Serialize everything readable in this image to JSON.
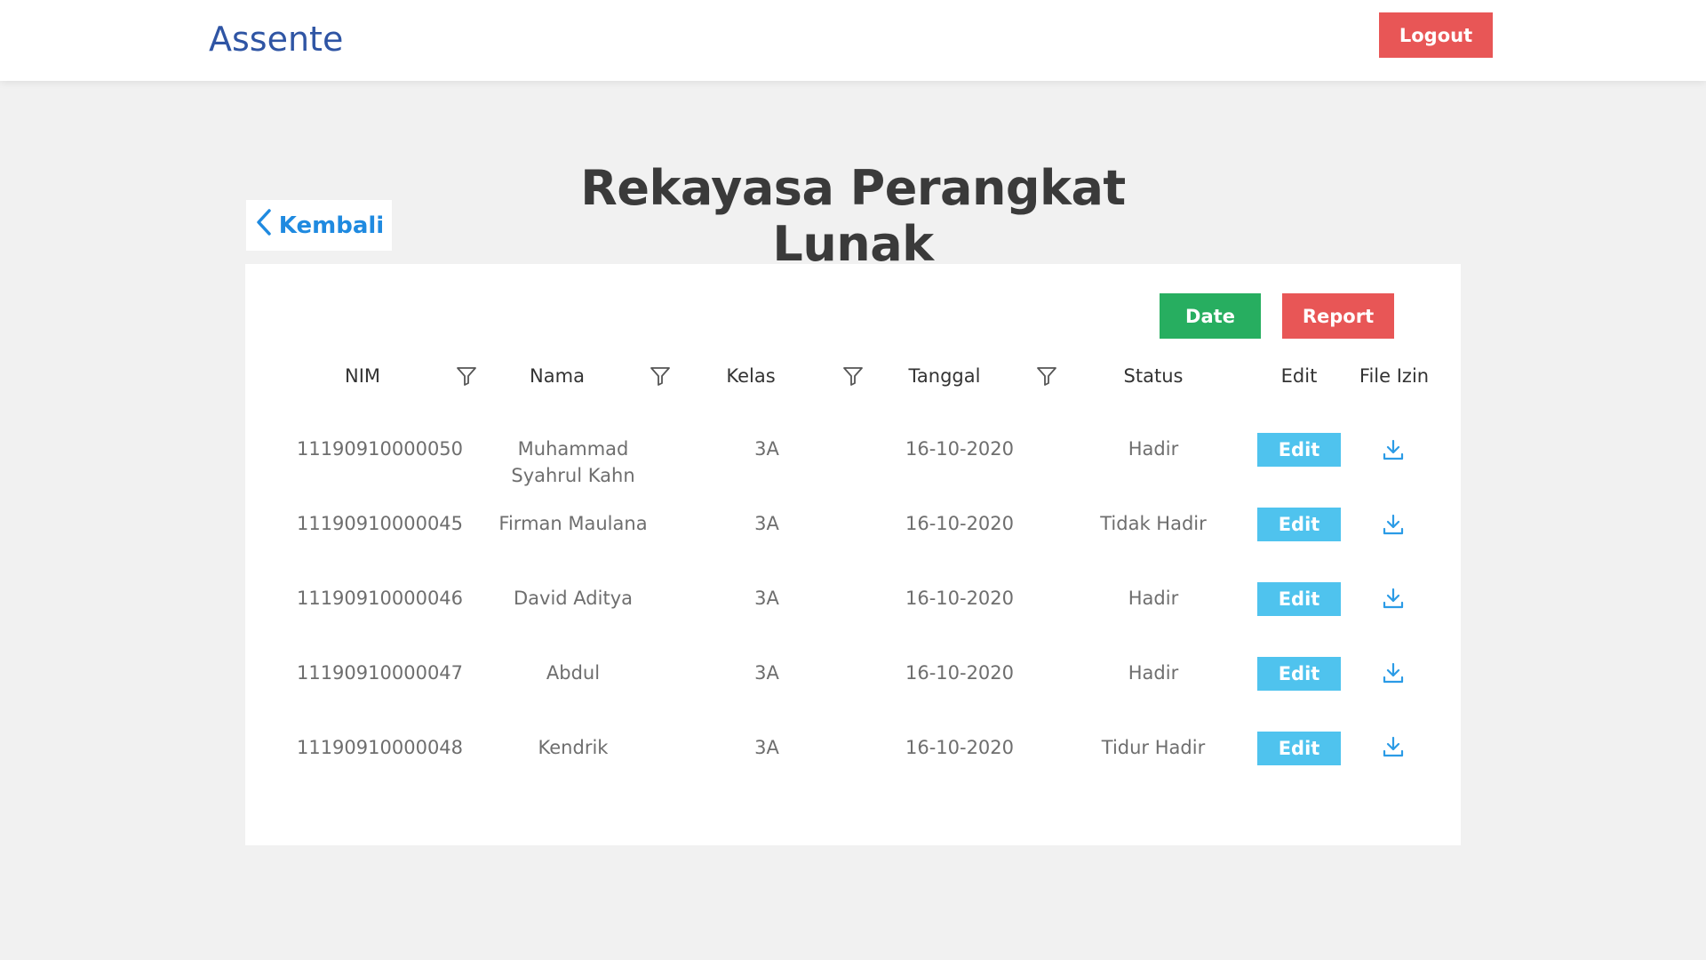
{
  "app": {
    "brand": "Assente",
    "logout_label": "Logout"
  },
  "page": {
    "title": "Rekayasa Perangkat Lunak",
    "back_label": "Kembali"
  },
  "actions": {
    "date_label": "Date",
    "report_label": "Report"
  },
  "table": {
    "headers": {
      "nim": "NIM",
      "nama": "Nama",
      "kelas": "Kelas",
      "tanggal": "Tanggal",
      "status": "Status",
      "edit": "Edit",
      "file": "File Izin"
    },
    "edit_label": "Edit",
    "rows": [
      {
        "nim": "11190910000050",
        "nama": "Muhammad Syahrul Kahn",
        "kelas": "3A",
        "tanggal": "16-10-2020",
        "status": "Hadir"
      },
      {
        "nim": "11190910000045",
        "nama": "Firman Maulana",
        "kelas": "3A",
        "tanggal": "16-10-2020",
        "status": "Tidak Hadir"
      },
      {
        "nim": "11190910000046",
        "nama": "David Aditya",
        "kelas": "3A",
        "tanggal": "16-10-2020",
        "status": "Hadir"
      },
      {
        "nim": "11190910000047",
        "nama": "Abdul",
        "kelas": "3A",
        "tanggal": "16-10-2020",
        "status": "Hadir"
      },
      {
        "nim": "11190910000048",
        "nama": "Kendrik",
        "kelas": "3A",
        "tanggal": "16-10-2020",
        "status": "Tidur Hadir"
      }
    ]
  },
  "colors": {
    "brand": "#2f55a4",
    "danger": "#e85656",
    "success": "#27ae60",
    "info": "#4fc3ee",
    "link": "#1f8ae0"
  }
}
